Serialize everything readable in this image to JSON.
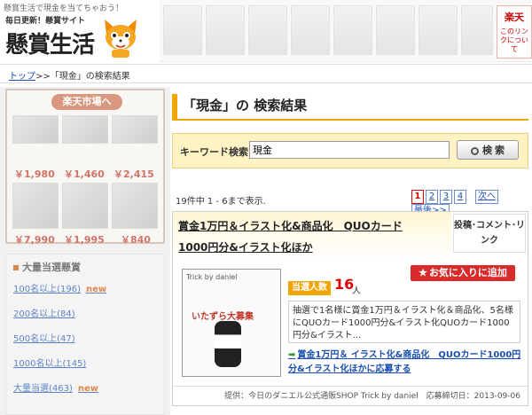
{
  "header": {
    "tagline": "懸賞生活で現金を当てちゃおう！",
    "logo_sub": "毎日更新！懸賞サイト",
    "logo_main": "懸賞生活",
    "rakuten_mini_title": "楽天",
    "rakuten_mini_sub": "このリンクについて"
  },
  "breadcrumb": {
    "home": "トップ",
    "separator": ">>",
    "current": "「現金」の検索結果"
  },
  "sidebar": {
    "rakuten_title": "楽天市場へ",
    "prices": [
      "￥1,980",
      "￥1,460",
      "￥2,415",
      "￥7,990",
      "￥1,995",
      "￥840"
    ],
    "section_title": "大量当選懸賞",
    "links": [
      {
        "label": "100名以上(196)",
        "new": "new"
      },
      {
        "label": "200名以上(84)",
        "new": ""
      },
      {
        "label": "500名以上(47)",
        "new": ""
      },
      {
        "label": "1000名以上(145)",
        "new": ""
      },
      {
        "label": "大量当選(463)",
        "new": "new"
      }
    ]
  },
  "main": {
    "title": "「現金」の 検索結果",
    "search": {
      "label": "キーワード検索",
      "value": "現金",
      "button": "検 索"
    },
    "results_count": "19件中 1 - 6まで表示.",
    "pager": {
      "pages": [
        "1",
        "2",
        "3",
        "4"
      ],
      "current": "1",
      "next": "次へ",
      "last": "最後>>"
    },
    "result": {
      "title_line1": "賞金1万円＆イラスト化&商品化　QUOカード",
      "title_line2": "1000円分&イラスト化ほか",
      "tag_line1": "投稿･コメント･リ",
      "tag_line2": "ンク",
      "favorite_button": "お気に入りに追加",
      "thumb_header": "Trick by daniel",
      "thumb_banner": "いたずら大募集",
      "winners_label": "当選人数",
      "winners_count": "16",
      "winners_unit": "人",
      "description": "抽選で1名様に賞金1万円＆イラスト化＆商品化、5名様にQUOカード1000円分&イラスト化QUOカード1000円分&イラスト...",
      "apply_text": "賞金1万円＆ イラスト化&商品化　QUOカード1000円分&イラスト化ほかに応募する",
      "footer": "提供：今日のダニエル公式通販SHOP Trick by daniel　応募締切日：2013-09-06"
    }
  }
}
